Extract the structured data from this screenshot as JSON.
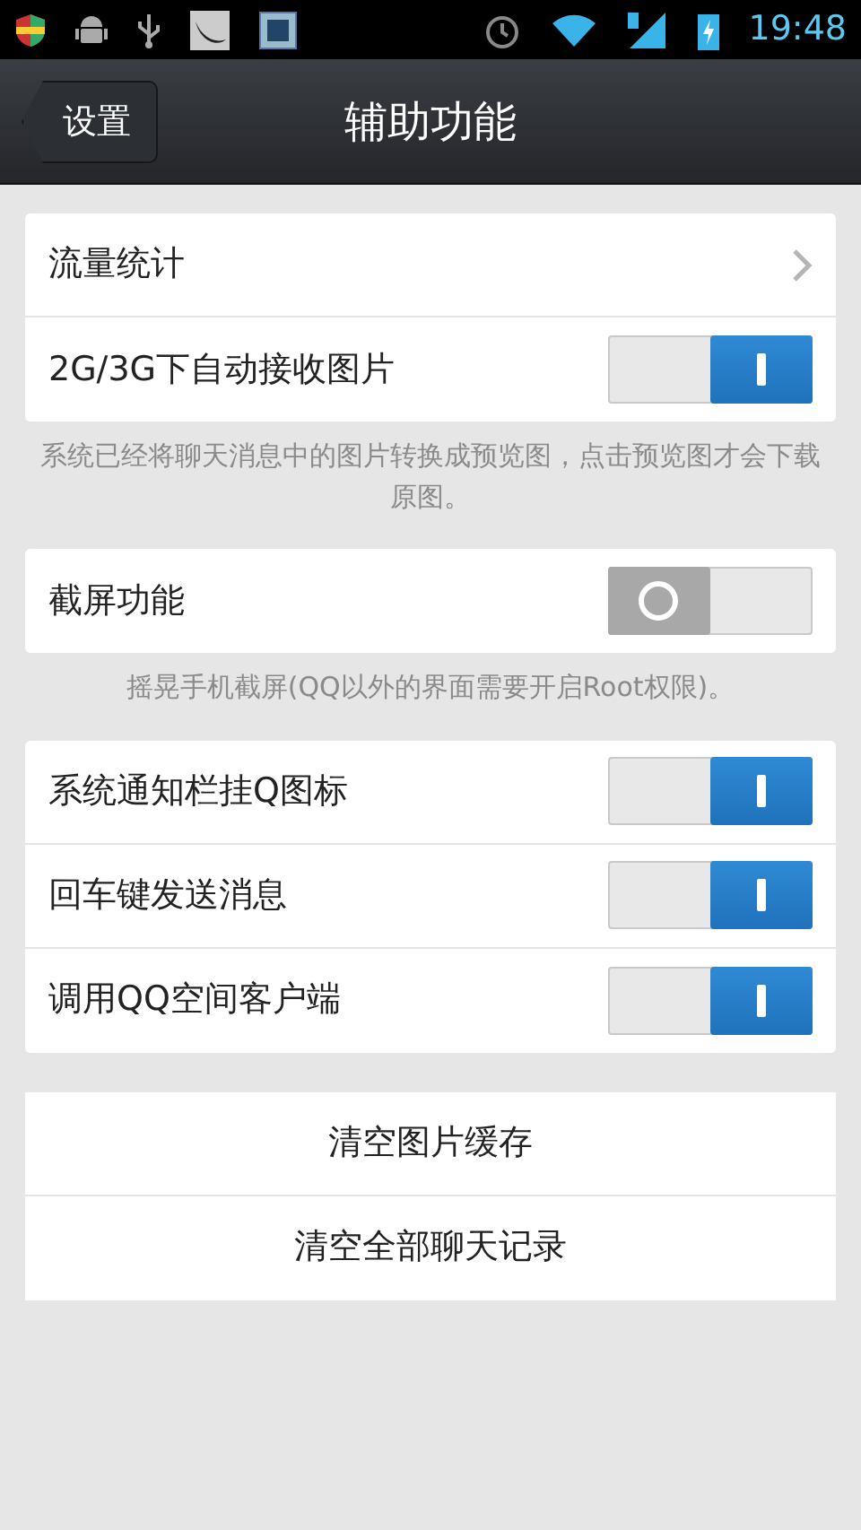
{
  "status_bar": {
    "time": "19:48"
  },
  "header": {
    "back_label": "设置",
    "title": "辅助功能"
  },
  "sections": [
    {
      "rows": [
        {
          "kind": "link",
          "label": "流量统计"
        },
        {
          "kind": "toggle",
          "label": "2G/3G下自动接收图片",
          "on": true
        }
      ],
      "note": "系统已经将聊天消息中的图片转换成预览图，点击预览图才会下载原图。"
    },
    {
      "rows": [
        {
          "kind": "toggle",
          "label": "截屏功能",
          "on": false
        }
      ],
      "note": "摇晃手机截屏(QQ以外的界面需要开启Root权限)。"
    },
    {
      "rows": [
        {
          "kind": "toggle",
          "label": "系统通知栏挂Q图标",
          "on": true
        },
        {
          "kind": "toggle",
          "label": "回车键发送消息",
          "on": true
        },
        {
          "kind": "toggle",
          "label": "调用QQ空间客户端",
          "on": true
        }
      ]
    }
  ],
  "actions": [
    "清空图片缓存",
    "清空全部聊天记录"
  ]
}
